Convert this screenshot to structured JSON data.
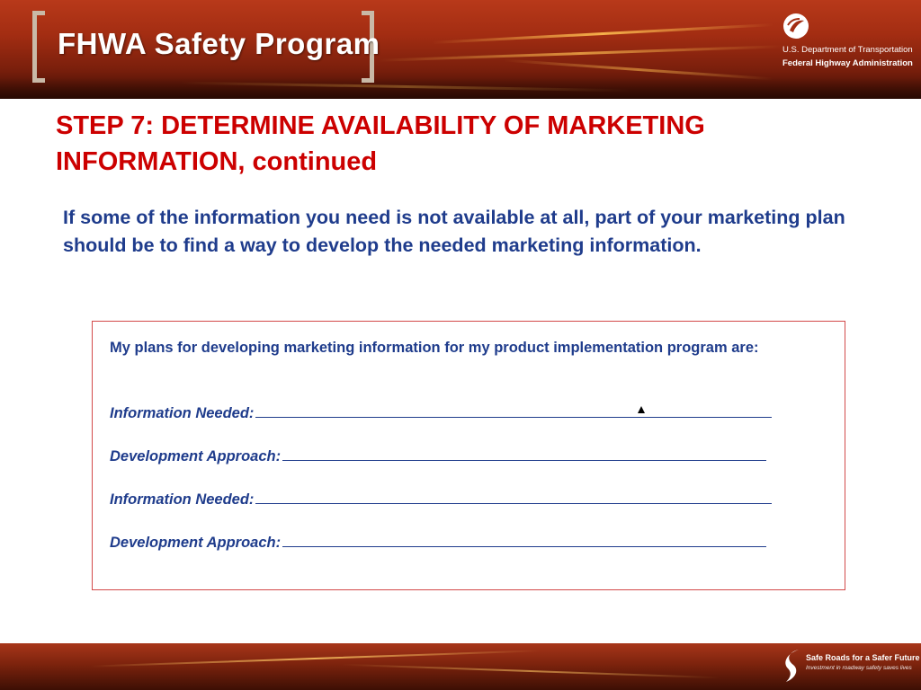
{
  "header": {
    "program_title": "FHWA Safety Program",
    "agency_line1": "U.S. Department of Transportation",
    "agency_line2": "Federal Highway Administration"
  },
  "slide": {
    "title_line1": "STEP 7: DETERMINE AVAILABILITY OF MARKETING",
    "title_line2": "INFORMATION, continued",
    "intro": "If some of the information you need is not available at all, part of your marketing plan should be to find a way to develop the needed marketing information."
  },
  "plan_box": {
    "lead": "My plans for developing marketing information for my product implementation program are:",
    "fields": [
      {
        "label": "Information Needed:"
      },
      {
        "label": "Development Approach:"
      },
      {
        "label": "Information Needed:"
      },
      {
        "label": "Development Approach:"
      }
    ]
  },
  "footer": {
    "tagline": "Safe Roads for a Safer Future",
    "subtagline": "Investment in roadway safety saves lives"
  },
  "colors": {
    "title_red": "#cc0000",
    "body_blue": "#1f3c8c",
    "banner_red": "#a32d12"
  }
}
